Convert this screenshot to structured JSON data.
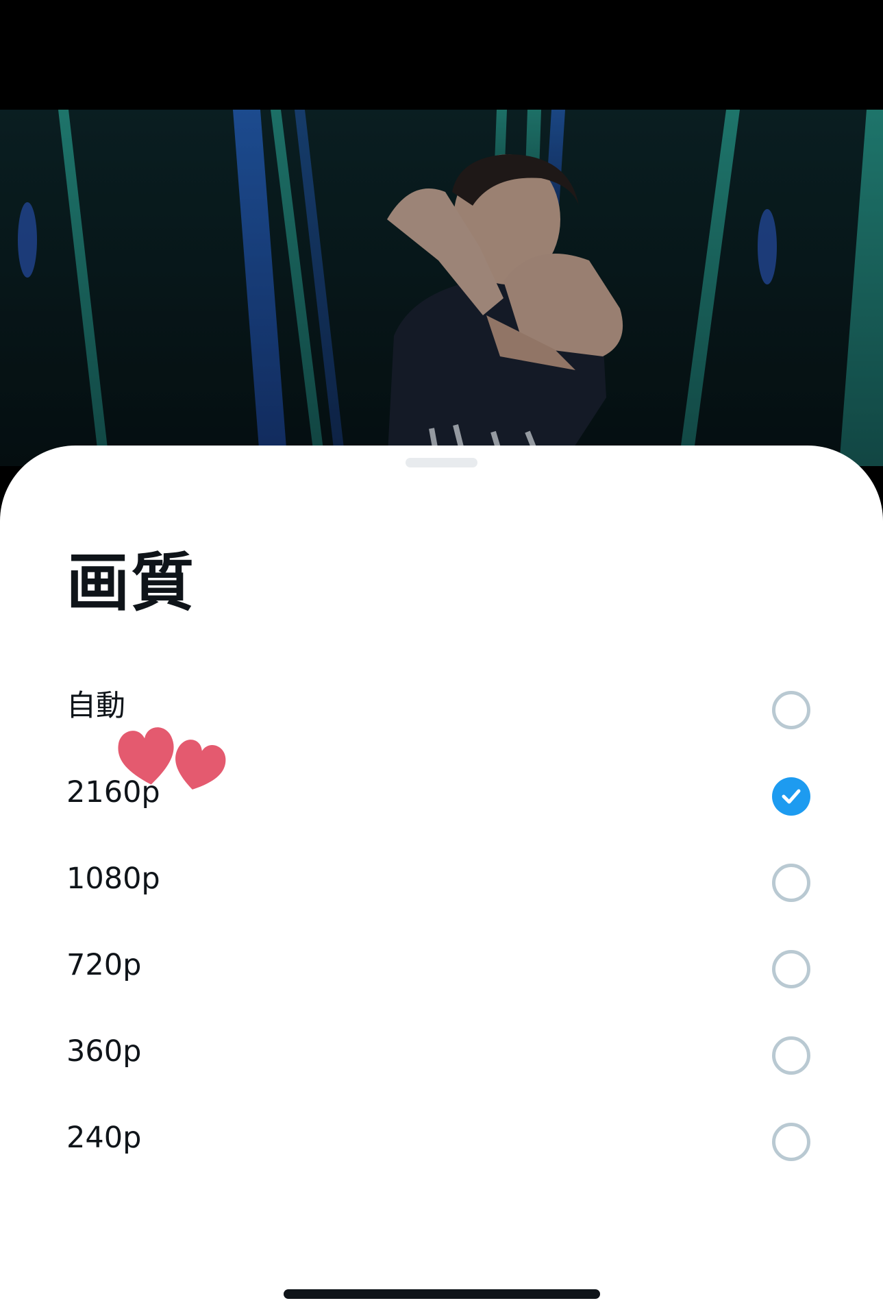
{
  "sheet": {
    "title": "画質",
    "options": [
      {
        "label": "自動",
        "selected": false
      },
      {
        "label": "2160p",
        "selected": true
      },
      {
        "label": "1080p",
        "selected": false
      },
      {
        "label": "720p",
        "selected": false
      },
      {
        "label": "360p",
        "selected": false
      },
      {
        "label": "240p",
        "selected": false
      }
    ]
  },
  "colors": {
    "accent": "#1d9bf0",
    "radio_border": "#b9c9d2",
    "text": "#0f1419",
    "heart": "#e45a6f"
  },
  "icons": {
    "selected": "checkmark-icon",
    "decoration": "heart-icon"
  }
}
